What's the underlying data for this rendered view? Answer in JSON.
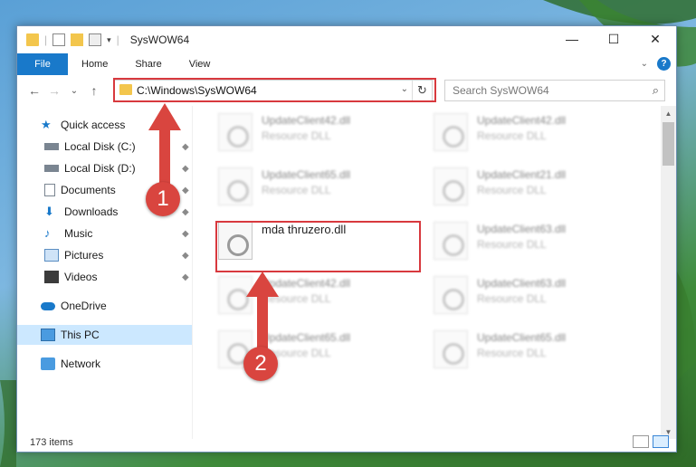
{
  "window": {
    "title": "SysWOW64",
    "controls": {
      "minimize": "—",
      "maximize": "☐",
      "close": "✕"
    }
  },
  "ribbon": {
    "tabs": [
      "File",
      "Home",
      "Share",
      "View"
    ],
    "help_label": "?"
  },
  "navigation": {
    "back": "←",
    "forward": "→",
    "recent": "⌄",
    "up": "↑",
    "address": "C:\\Windows\\SysWOW64",
    "refresh": "↻",
    "search_placeholder": "Search SysWOW64",
    "search_icon": "⌕"
  },
  "sidebar": {
    "items": [
      {
        "label": "Quick access",
        "icon": "star-icon"
      },
      {
        "label": "Local Disk (C:)",
        "icon": "drive-icon",
        "pinned": true
      },
      {
        "label": "Local Disk (D:)",
        "icon": "drive-icon",
        "pinned": true
      },
      {
        "label": "Documents",
        "icon": "document-icon",
        "pinned": true
      },
      {
        "label": "Downloads",
        "icon": "download-icon",
        "pinned": true
      },
      {
        "label": "Music",
        "icon": "music-icon",
        "pinned": true
      },
      {
        "label": "Pictures",
        "icon": "picture-icon",
        "pinned": true
      },
      {
        "label": "Videos",
        "icon": "video-icon",
        "pinned": true
      },
      {
        "label": "OneDrive",
        "icon": "cloud-icon"
      },
      {
        "label": "This PC",
        "icon": "computer-icon",
        "selected": true
      },
      {
        "label": "Network",
        "icon": "network-icon"
      }
    ],
    "pin_glyph": "📌"
  },
  "files": [
    {
      "name": "UpdateClient42.dll",
      "type": "Resource DLL"
    },
    {
      "name": "UpdateClient42.dll",
      "type": "Resource DLL"
    },
    {
      "name": "UpdateClient65.dll",
      "type": "Resource DLL"
    },
    {
      "name": "UpdateClient21.dll",
      "type": "Resource DLL"
    },
    {
      "name": "mda thruzero.dll",
      "type": ""
    },
    {
      "name": "UpdateClient63.dll",
      "type": "Resource DLL"
    },
    {
      "name": "UpdateClient42.dll",
      "type": "Resource DLL"
    },
    {
      "name": "UpdateClient63.dll",
      "type": "Resource DLL"
    },
    {
      "name": "UpdateClient65.dll",
      "type": "Resource DLL"
    },
    {
      "name": "UpdateClient65.dll",
      "type": "Resource DLL"
    }
  ],
  "status": {
    "item_count": "173 items"
  },
  "annotations": {
    "step1": "1",
    "step2": "2"
  },
  "colors": {
    "accent": "#1979ca",
    "highlight": "#d8393e",
    "selected": "#cce8ff"
  }
}
